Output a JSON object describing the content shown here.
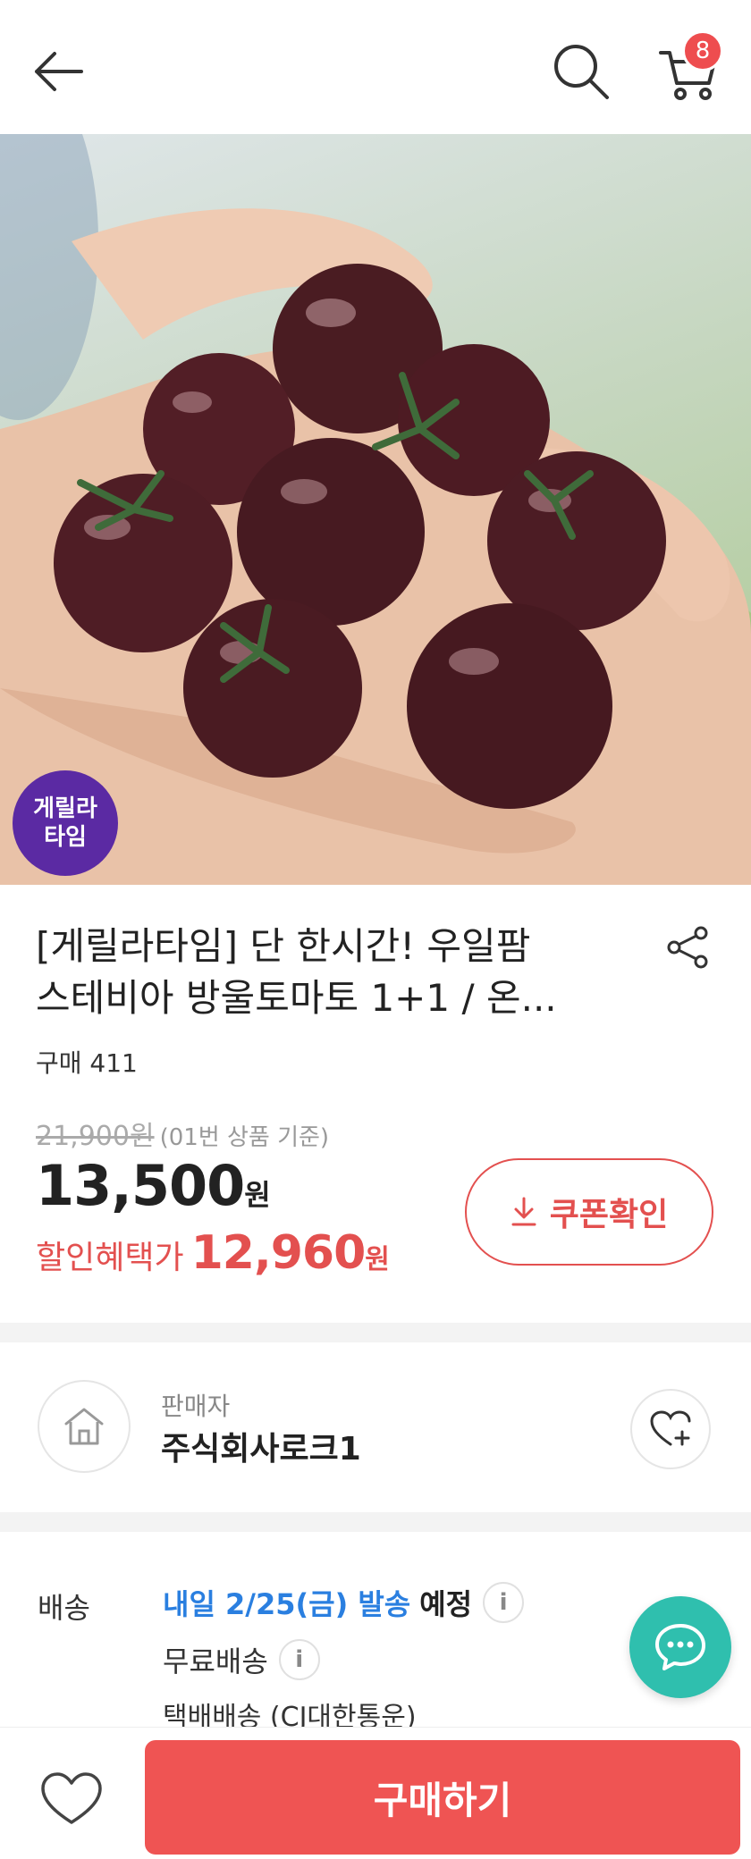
{
  "header": {
    "cart_count": "8"
  },
  "hero": {
    "badge_line1": "게릴라",
    "badge_line2": "타임"
  },
  "product": {
    "title_line1": "[게릴라타임] 단 한시간! 우일팜",
    "title_line2": "스테비아 방울토마토 1+1 / 온...",
    "purchase_count": "구매 411",
    "original_price": "21,900원",
    "original_price_note": "(01번 상품 기준)",
    "price": "13,500",
    "price_unit": "원",
    "discount_label": "할인혜택가",
    "discount_price": "12,960",
    "discount_unit": "원",
    "coupon_label": "쿠폰확인"
  },
  "seller": {
    "caption": "판매자",
    "name": "주식회사로크1"
  },
  "shipping": {
    "label": "배송",
    "date_text": "내일 2/25(금) 발송",
    "expect_text": "예정",
    "fee_text": "무료배송",
    "courier_text": "택배배송 (CJ대한통운)",
    "info_glyph": "i"
  },
  "bottom": {
    "buy_label": "구매하기"
  },
  "colors": {
    "accent_red": "#ef5453",
    "discount_red": "#e3504f",
    "shipping_blue": "#2a7fe0",
    "chat_teal": "#2fbfae",
    "badge_purple": "#5b2aa3"
  }
}
